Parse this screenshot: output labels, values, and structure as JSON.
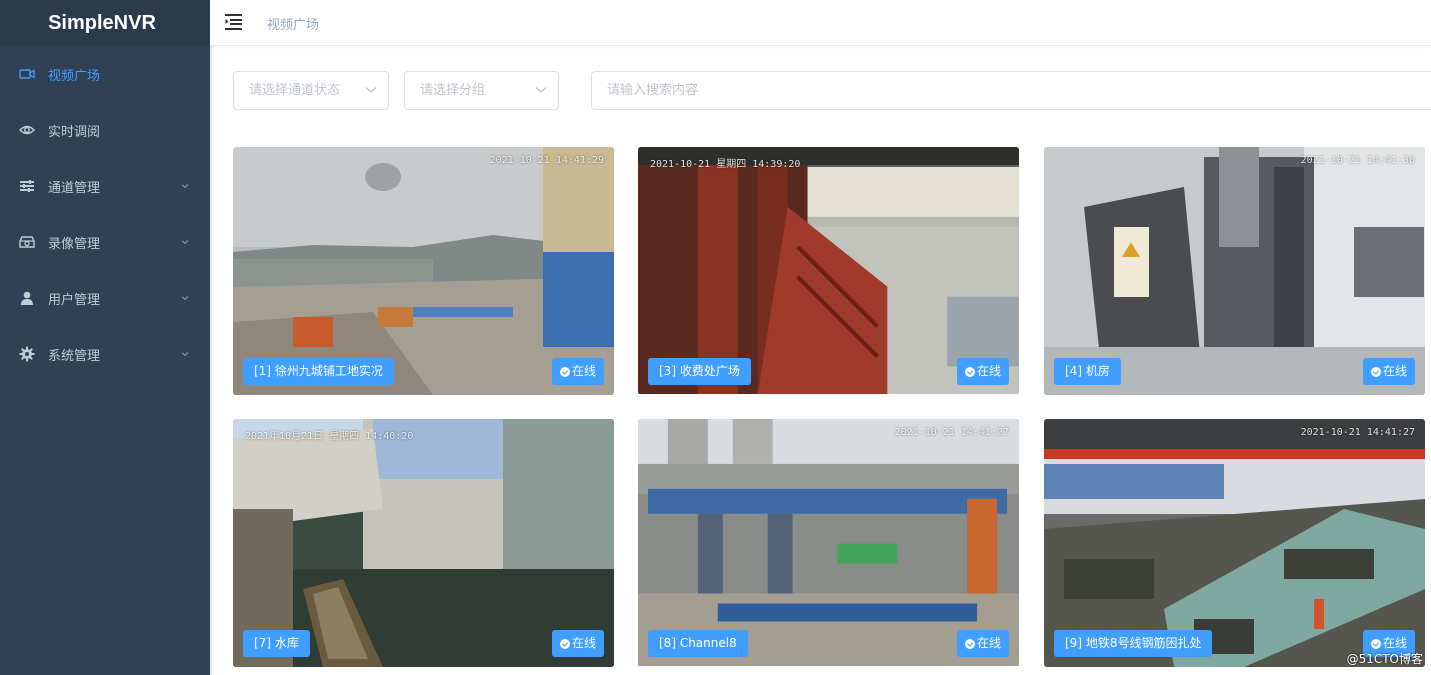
{
  "app": {
    "title": "SimpleNVR"
  },
  "sidebar": {
    "items": [
      {
        "label": "视频广场",
        "icon": "video-camera-icon",
        "active": true,
        "has_children": false
      },
      {
        "label": "实时调阅",
        "icon": "eye-icon",
        "active": false,
        "has_children": false
      },
      {
        "label": "通道管理",
        "icon": "sliders-icon",
        "active": false,
        "has_children": true
      },
      {
        "label": "录像管理",
        "icon": "recorder-icon",
        "active": false,
        "has_children": true
      },
      {
        "label": "用户管理",
        "icon": "user-icon",
        "active": false,
        "has_children": true
      },
      {
        "label": "系统管理",
        "icon": "gear-icon",
        "active": false,
        "has_children": true
      }
    ]
  },
  "header": {
    "breadcrumb": "视频广场"
  },
  "filters": {
    "status_placeholder": "请选择通道状态",
    "group_placeholder": "请选择分组",
    "search_placeholder": "请输入搜索内容"
  },
  "channels": [
    {
      "name": "[1] 徐州九城铺工地实况",
      "status": "在线",
      "timestamp": "2021-10-21 14:41:29"
    },
    {
      "name": "[3] 收费处广场",
      "status": "在线",
      "timestamp": "2021-10-21 星期四 14:39:20"
    },
    {
      "name": "[4] 机房",
      "status": "在线",
      "timestamp": "2021-10-21 14:41:36"
    },
    {
      "name": "[7] 水库",
      "status": "在线",
      "timestamp": "2021年10月21日 星期四 14:40:20"
    },
    {
      "name": "[8] Channel8",
      "status": "在线",
      "timestamp": "2021-10-21 14:41:27"
    },
    {
      "name": "[9] 地铁8号线钢筋困扎处",
      "status": "在线",
      "timestamp": "2021-10-21 14:41:27"
    }
  ],
  "watermark": "@51CTO博客",
  "colors": {
    "sidebar_bg": "#304156",
    "accent": "#409eff",
    "menu_text": "#bfcbd9"
  }
}
